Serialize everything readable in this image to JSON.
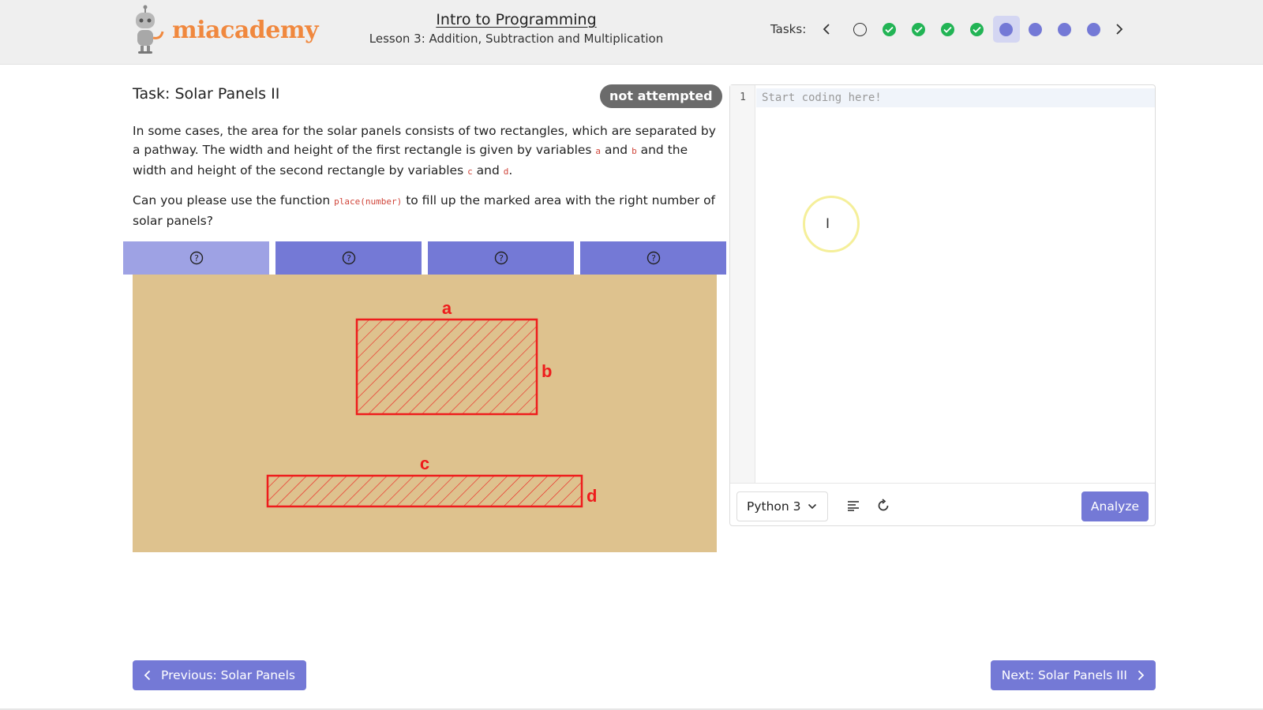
{
  "app": {
    "brand": "miacademy",
    "course_title": "Intro to Programming",
    "lesson_title": "Lesson 3: Addition, Subtraction and Multiplication"
  },
  "tasks_bar": {
    "label": "Tasks:",
    "items": [
      {
        "status": "not-started"
      },
      {
        "status": "completed"
      },
      {
        "status": "completed"
      },
      {
        "status": "completed"
      },
      {
        "status": "completed"
      },
      {
        "status": "current"
      },
      {
        "status": "pending"
      },
      {
        "status": "pending"
      },
      {
        "status": "pending"
      }
    ]
  },
  "task": {
    "title": "Task: Solar Panels II",
    "status": "not attempted",
    "p1": {
      "t1": "In some cases, the area for the solar panels consists of two rectangles, which are separated by a pathway. The width and height of the first rectangle is given by variables ",
      "var_a": "a",
      "t2": " and ",
      "var_b": "b",
      "t3": " and the width and height of the second rectangle by variables ",
      "var_c": "c",
      "t4": " and ",
      "var_d": "d",
      "t5": "."
    },
    "p2": {
      "t1": "Can you please use the function ",
      "code": "place(number)",
      "t2": " to fill up the marked area with the right number of solar panels?"
    }
  },
  "hint_tabs": [
    "hint-1",
    "hint-2",
    "hint-3",
    "hint-4"
  ],
  "diagram": {
    "rect1": {
      "width_label": "a",
      "height_label": "b"
    },
    "rect2": {
      "width_label": "c",
      "height_label": "d"
    },
    "colors": {
      "ground": "#dec28e",
      "outline": "#ee1c1c"
    }
  },
  "editor": {
    "line_number": "1",
    "placeholder": "Start coding here!",
    "language": "Python 3",
    "analyze_label": "Analyze"
  },
  "navigation": {
    "prev_label": "Previous: Solar Panels",
    "next_label": "Next: Solar Panels III"
  },
  "colors": {
    "accent": "#7479d6",
    "success": "#22b455",
    "brand": "#f0883e",
    "badge": "#6b6b6b"
  }
}
